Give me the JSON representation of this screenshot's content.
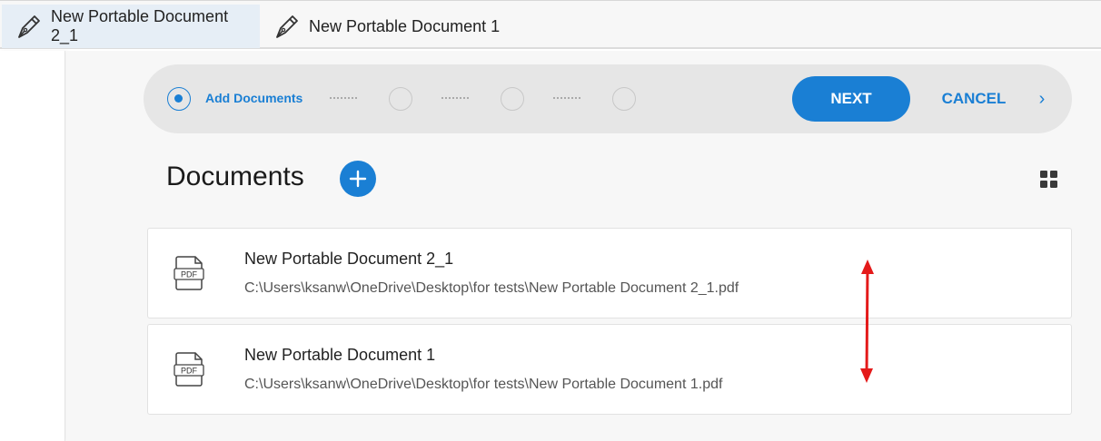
{
  "tabs": [
    {
      "label": "New Portable Document 2_1",
      "active": true
    },
    {
      "label": "New Portable Document 1",
      "active": false
    }
  ],
  "stepper": {
    "active_step_label": "Add Documents",
    "next_label": "NEXT",
    "cancel_label": "CANCEL",
    "chevron": "›"
  },
  "documents": {
    "title": "Documents",
    "add_icon": "plus-icon",
    "view_icon": "grid-view-icon",
    "items": [
      {
        "name": "New Portable Document 2_1",
        "path": "C:\\Users\\ksanw\\OneDrive\\Desktop\\for tests\\New Portable Document 2_1.pdf",
        "icon_text": "PDF"
      },
      {
        "name": "New Portable Document 1",
        "path": "C:\\Users\\ksanw\\OneDrive\\Desktop\\for tests\\New Portable Document 1.pdf",
        "icon_text": "PDF"
      }
    ]
  },
  "colors": {
    "accent": "#1a7fd4",
    "annotation_arrow": "#e41a1a"
  }
}
